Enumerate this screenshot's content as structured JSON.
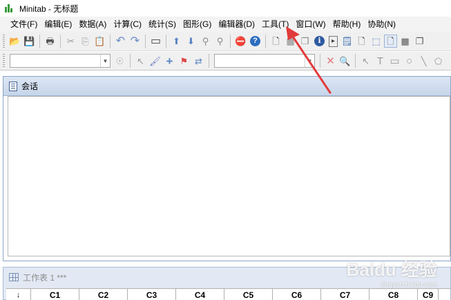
{
  "window": {
    "title": "Minitab - 无标题"
  },
  "menu": [
    {
      "label": "文件(F)"
    },
    {
      "label": "编辑(E)"
    },
    {
      "label": "数据(A)"
    },
    {
      "label": "计算(C)"
    },
    {
      "label": "统计(S)"
    },
    {
      "label": "图形(G)"
    },
    {
      "label": "编辑器(D)"
    },
    {
      "label": "工具(T)"
    },
    {
      "label": "窗口(W)"
    },
    {
      "label": "帮助(H)"
    },
    {
      "label": "协助(N)"
    }
  ],
  "toolbar1": [
    {
      "icon": "open-folder-icon",
      "glyph": "📂"
    },
    {
      "icon": "save-icon",
      "glyph": "💾"
    },
    {
      "icon": "print-icon",
      "glyph": "🖶"
    },
    {
      "icon": "cut-icon",
      "glyph": "✂"
    },
    {
      "icon": "copy-icon",
      "glyph": "⎘"
    },
    {
      "icon": "paste-icon",
      "glyph": "📋"
    },
    {
      "icon": "undo-icon",
      "glyph": "↶"
    },
    {
      "icon": "redo-icon",
      "glyph": "↷"
    },
    {
      "icon": "window-icon",
      "glyph": "▭"
    },
    {
      "icon": "arrow-up-icon",
      "glyph": "⬆"
    },
    {
      "icon": "arrow-down-icon",
      "glyph": "⬇"
    },
    {
      "icon": "find-icon",
      "glyph": "⚲"
    },
    {
      "icon": "find-next-icon",
      "glyph": "⚲"
    },
    {
      "icon": "cancel-icon",
      "glyph": "⛔"
    },
    {
      "icon": "help-icon",
      "glyph": "?"
    },
    {
      "icon": "new-worksheet-icon",
      "glyph": "🗋"
    },
    {
      "icon": "worksheet-icon",
      "glyph": "▦"
    },
    {
      "icon": "layers-icon",
      "glyph": "❐"
    },
    {
      "icon": "info-icon",
      "glyph": "ℹ"
    },
    {
      "icon": "command-icon",
      "glyph": "▸"
    },
    {
      "icon": "notepad-icon",
      "glyph": "🗒"
    },
    {
      "icon": "new-graph-icon",
      "glyph": "🗋"
    },
    {
      "icon": "select-region-icon",
      "glyph": "⬚"
    },
    {
      "icon": "page-icon",
      "glyph": "🗋"
    },
    {
      "icon": "table-icon",
      "glyph": "▦"
    },
    {
      "icon": "copy-window-icon",
      "glyph": "❐"
    }
  ],
  "toolbar2": {
    "pointer_icon": "↖",
    "brush_icon": "🖌",
    "plus_icon": "+",
    "flag_icon": "⚑",
    "swap_icon": "⇄",
    "delete_icon": "✕",
    "zoom_icon": "🔍",
    "text_icon": "T",
    "rect_icon": "▭",
    "circle_icon": "○",
    "line_icon": "╲",
    "shape_icon": "⬠"
  },
  "session": {
    "title": "会话"
  },
  "worksheet": {
    "title": "工作表 1 ***",
    "arrow": "↓",
    "columns": [
      "C1",
      "C2",
      "C3",
      "C4",
      "C5",
      "C6",
      "C7",
      "C8",
      "C9"
    ]
  },
  "watermark": {
    "brand": "Baidu 经验",
    "url": "jingyan.baidu.com"
  },
  "colors": {
    "menu_bg": "#f3f3f3",
    "session_header": "#c6d5ea",
    "annotation_arrow": "#e23b3b"
  }
}
